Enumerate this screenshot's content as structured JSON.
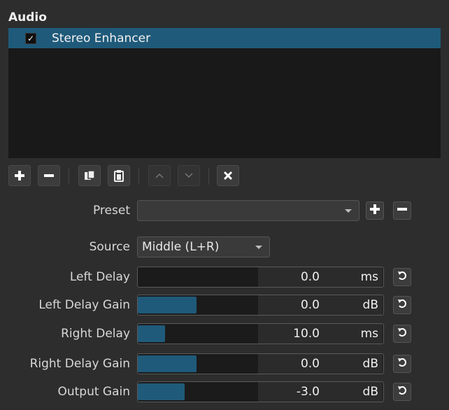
{
  "panel": {
    "title": "Audio"
  },
  "filters": [
    {
      "name": "Stereo Enhancer",
      "check": "✓",
      "enabled": true
    }
  ],
  "toolbar": {
    "buttons": [
      {
        "name": "add-filter-button",
        "icon": "plus-icon",
        "enabled": true
      },
      {
        "name": "remove-filter-button",
        "icon": "minus-icon",
        "enabled": true
      },
      {
        "name": "copy-filter-button",
        "icon": "copy-icon",
        "enabled": true
      },
      {
        "name": "paste-filter-button",
        "icon": "paste-icon",
        "enabled": true
      },
      {
        "name": "move-up-button",
        "icon": "chevron-up-icon",
        "enabled": false
      },
      {
        "name": "move-down-button",
        "icon": "chevron-down-icon",
        "enabled": false
      },
      {
        "name": "deselect-button",
        "icon": "close-icon",
        "enabled": true
      }
    ]
  },
  "preset": {
    "label": "Preset",
    "value": ""
  },
  "source": {
    "label": "Source",
    "value": "Middle (L+R)"
  },
  "params": [
    {
      "label": "Left Delay",
      "value": "0.0",
      "unit": "ms",
      "level": 0.0
    },
    {
      "label": "Left Delay Gain",
      "value": "0.0",
      "unit": "dB",
      "level": 0.24
    },
    {
      "label": "Right Delay",
      "value": "10.0",
      "unit": "ms",
      "level": 0.11
    },
    {
      "label": "Right Delay Gain",
      "value": "0.0",
      "unit": "dB",
      "level": 0.24
    },
    {
      "label": "Output Gain",
      "value": "-3.0",
      "unit": "dB",
      "level": 0.19
    }
  ],
  "colors": {
    "accent": "#1f5a7a",
    "background": "#2d2d2d",
    "list_background": "#191919"
  }
}
